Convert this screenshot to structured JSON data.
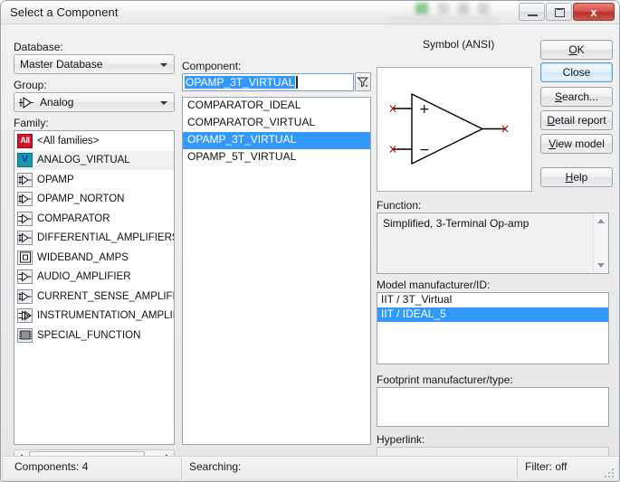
{
  "window": {
    "title": "Select a Component",
    "minimize_label": "Minimize",
    "maximize_label": "Maximize",
    "close_label": "x"
  },
  "left_panel": {
    "database_label": "Database:",
    "database_value": "Master Database",
    "group_label": "Group:",
    "group_value": "Analog",
    "family_label": "Family:",
    "families": [
      {
        "label": "<All families>",
        "icon": "all-families-icon",
        "selected": false
      },
      {
        "label": "ANALOG_VIRTUAL",
        "icon": "analog-virtual-icon",
        "selected": true
      },
      {
        "label": "OPAMP",
        "icon": "opamp-icon",
        "selected": false
      },
      {
        "label": "OPAMP_NORTON",
        "icon": "opamp-norton-icon",
        "selected": false
      },
      {
        "label": "COMPARATOR",
        "icon": "comparator-icon",
        "selected": false
      },
      {
        "label": "DIFFERENTIAL_AMPLIFIERS",
        "icon": "differential-amplifier-icon",
        "selected": false
      },
      {
        "label": "WIDEBAND_AMPS",
        "icon": "wideband-amp-icon",
        "selected": false
      },
      {
        "label": "AUDIO_AMPLIFIER",
        "icon": "audio-amplifier-icon",
        "selected": false
      },
      {
        "label": "CURRENT_SENSE_AMPLIFIERS",
        "icon": "current-sense-amplifier-icon",
        "selected": false
      },
      {
        "label": "INSTRUMENTATION_AMPLIFIERS",
        "icon": "instrumentation-amplifier-icon",
        "selected": false
      },
      {
        "label": "SPECIAL_FUNCTION",
        "icon": "special-function-icon",
        "selected": false
      }
    ]
  },
  "component_panel": {
    "label": "Component:",
    "input_value": "OPAMP_3T_VIRTUAL",
    "input_placeholder": "",
    "filter_button_label": "filter-icon",
    "items": [
      {
        "label": "COMPARATOR_IDEAL",
        "selected": false
      },
      {
        "label": "COMPARATOR_VIRTUAL",
        "selected": false
      },
      {
        "label": "OPAMP_3T_VIRTUAL",
        "selected": true
      },
      {
        "label": "OPAMP_5T_VIRTUAL",
        "selected": false
      }
    ]
  },
  "symbol": {
    "label": "Symbol (ANSI)",
    "plus_sign": "+",
    "minus_sign": "−"
  },
  "buttons": {
    "ok": {
      "pre": "",
      "accel": "O",
      "post": "K"
    },
    "close": {
      "pre": "",
      "accel": "",
      "post": "Close"
    },
    "search": {
      "pre": "",
      "accel": "S",
      "post": "earch..."
    },
    "detail_report": {
      "pre": "",
      "accel": "D",
      "post": "etail report"
    },
    "view_model": {
      "pre": "",
      "accel": "V",
      "post": "iew model"
    },
    "help": {
      "pre": "",
      "accel": "H",
      "post": "elp"
    }
  },
  "function": {
    "label": "Function:",
    "value": "Simplified, 3-Terminal Op-amp"
  },
  "model": {
    "label": "Model manufacturer/ID:",
    "items": [
      {
        "label": "IIT / 3T_Virtual",
        "selected": false
      },
      {
        "label": "IIT / IDEAL_5",
        "selected": true
      }
    ]
  },
  "footprint": {
    "label": "Footprint manufacturer/type:",
    "items": []
  },
  "hyperlink": {
    "label": "Hyperlink:",
    "value": ""
  },
  "statusbar": {
    "components": "Components: 4",
    "searching": "Searching:",
    "filter": "Filter: off"
  },
  "colors": {
    "selection_blue": "#3399ff",
    "close_red": "#c0392b",
    "all_icon_red": "#d4122a",
    "virtual_icon_teal": "#1b97ad"
  }
}
